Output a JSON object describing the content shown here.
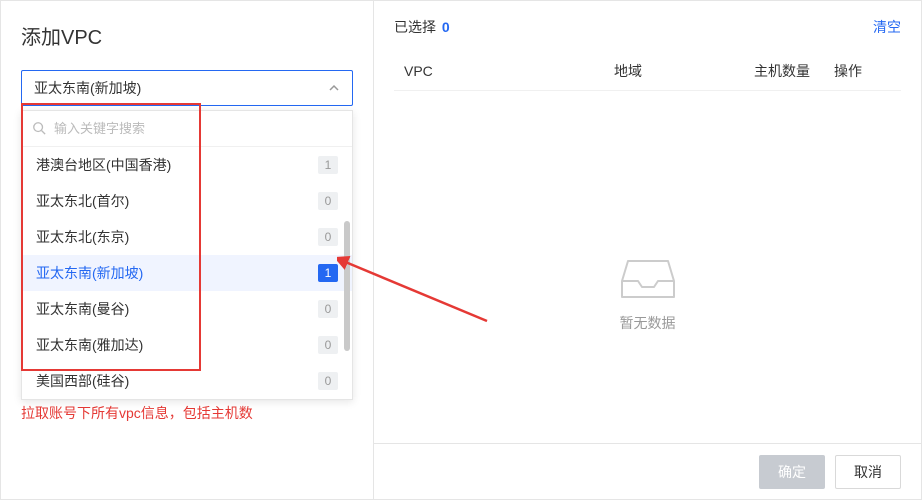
{
  "title": "添加VPC",
  "select": {
    "selected_label": "亚太东南(新加坡)",
    "search_placeholder": "输入关键字搜索"
  },
  "options": [
    {
      "label": "港澳台地区(中国香港)",
      "count": "1",
      "selected": false
    },
    {
      "label": "亚太东北(首尔)",
      "count": "0",
      "selected": false
    },
    {
      "label": "亚太东北(东京)",
      "count": "0",
      "selected": false
    },
    {
      "label": "亚太东南(新加坡)",
      "count": "1",
      "selected": true
    },
    {
      "label": "亚太东南(曼谷)",
      "count": "0",
      "selected": false
    },
    {
      "label": "亚太东南(雅加达)",
      "count": "0",
      "selected": false
    },
    {
      "label": "美国西部(硅谷)",
      "count": "0",
      "selected": false
    }
  ],
  "note": "拉取账号下所有vpc信息，包括主机数",
  "right": {
    "selected_label": "已选择",
    "selected_count": "0",
    "clear": "清空",
    "columns": {
      "vpc": "VPC",
      "region": "地域",
      "host": "主机数量",
      "op": "操作"
    },
    "empty": "暂无数据"
  },
  "buttons": {
    "ok": "确定",
    "cancel": "取消"
  }
}
